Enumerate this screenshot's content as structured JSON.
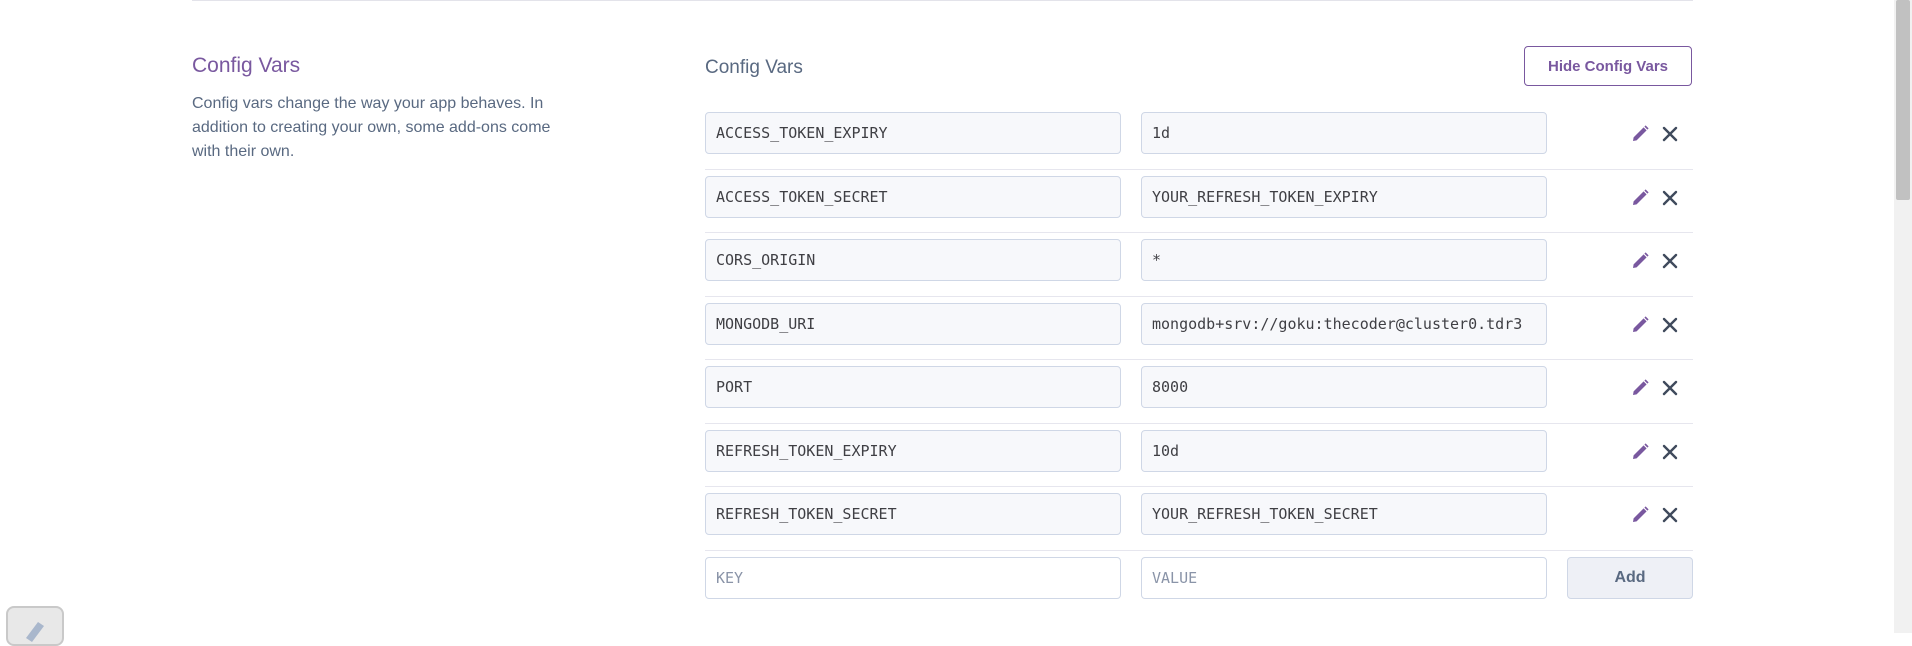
{
  "section": {
    "title": "Config Vars",
    "description": "Config vars change the way your app behaves. In addition to creating your own, some add-ons come with their own."
  },
  "panel": {
    "title": "Config Vars",
    "hide_button_label": "Hide Config Vars"
  },
  "config_vars": [
    {
      "key": "ACCESS_TOKEN_EXPIRY",
      "value": "1d"
    },
    {
      "key": "ACCESS_TOKEN_SECRET",
      "value": "YOUR_REFRESH_TOKEN_EXPIRY"
    },
    {
      "key": "CORS_ORIGIN",
      "value": "*"
    },
    {
      "key": "MONGODB_URI",
      "value": "mongodb+srv://goku:thecoder@cluster0.tdr3"
    },
    {
      "key": "PORT",
      "value": "8000"
    },
    {
      "key": "REFRESH_TOKEN_EXPIRY",
      "value": "10d"
    },
    {
      "key": "REFRESH_TOKEN_SECRET",
      "value": "YOUR_REFRESH_TOKEN_SECRET"
    }
  ],
  "new_var": {
    "key_placeholder": "KEY",
    "value_placeholder": "VALUE",
    "add_label": "Add"
  },
  "icons": {
    "edit": "pencil-icon",
    "delete": "close-icon"
  },
  "colors": {
    "accent": "#79589f",
    "muted_text": "#596981",
    "field_border": "#cfd7e6"
  }
}
